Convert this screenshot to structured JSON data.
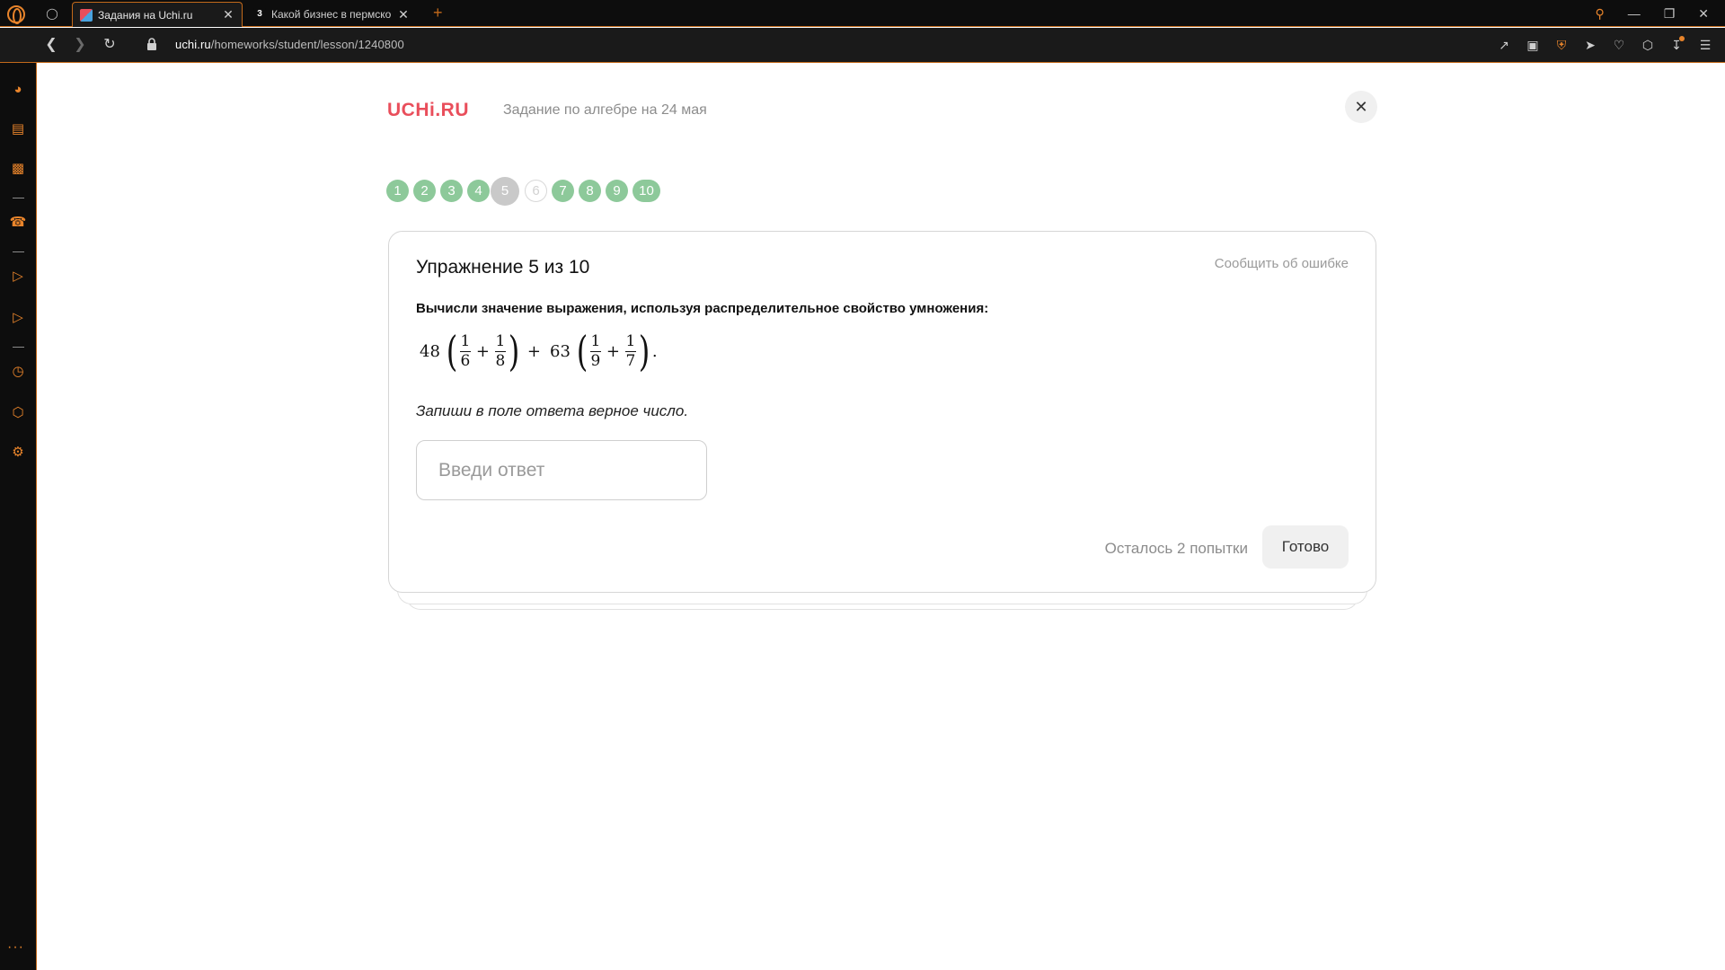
{
  "browser": {
    "tabs": [
      {
        "label": "Задания на Uchi.ru",
        "active": true
      },
      {
        "label": "Какой бизнес в пермском",
        "active": false,
        "favicon_text": "3"
      }
    ],
    "new_tab_icon": "plus-icon",
    "url": {
      "host": "uchi.ru",
      "path": "/homeworks/student/lesson/1240800"
    },
    "accent_color": "#e8842b",
    "chrome_bg": "#0d0d0d"
  },
  "header": {
    "logo": "UCHi.RU",
    "assignment_title": "Задание по алгебре на 24 мая",
    "close_icon": "close-icon"
  },
  "steps": [
    {
      "label": "1",
      "state": "done"
    },
    {
      "label": "2",
      "state": "done"
    },
    {
      "label": "3",
      "state": "done"
    },
    {
      "label": "4",
      "state": "done"
    },
    {
      "label": "5",
      "state": "current"
    },
    {
      "label": "6",
      "state": "empty"
    },
    {
      "label": "7",
      "state": "done"
    },
    {
      "label": "8",
      "state": "done"
    },
    {
      "label": "9",
      "state": "done"
    },
    {
      "label": "10",
      "state": "done"
    }
  ],
  "exercise": {
    "title": "Упражнение 5 из 10",
    "report_link": "Сообщить об ошибке",
    "instruction": "Вычисли значение выражения, используя распределительное свойство умножения:",
    "formula": {
      "a": "48",
      "a_fracs": [
        {
          "n": "1",
          "d": "6"
        },
        {
          "n": "1",
          "d": "8"
        }
      ],
      "plus": "+",
      "b": "63",
      "b_fracs": [
        {
          "n": "1",
          "d": "9"
        },
        {
          "n": "1",
          "d": "7"
        }
      ],
      "end": "."
    },
    "hint": "Запиши в поле ответа верное число.",
    "answer_placeholder": "Введи ответ",
    "answer_value": "",
    "attempts_text": "Осталось 2 попытки",
    "submit_label": "Готово"
  },
  "colors": {
    "logo": "#e94e5b",
    "step_done": "#8dc99a",
    "step_current": "#c9c9c9"
  }
}
